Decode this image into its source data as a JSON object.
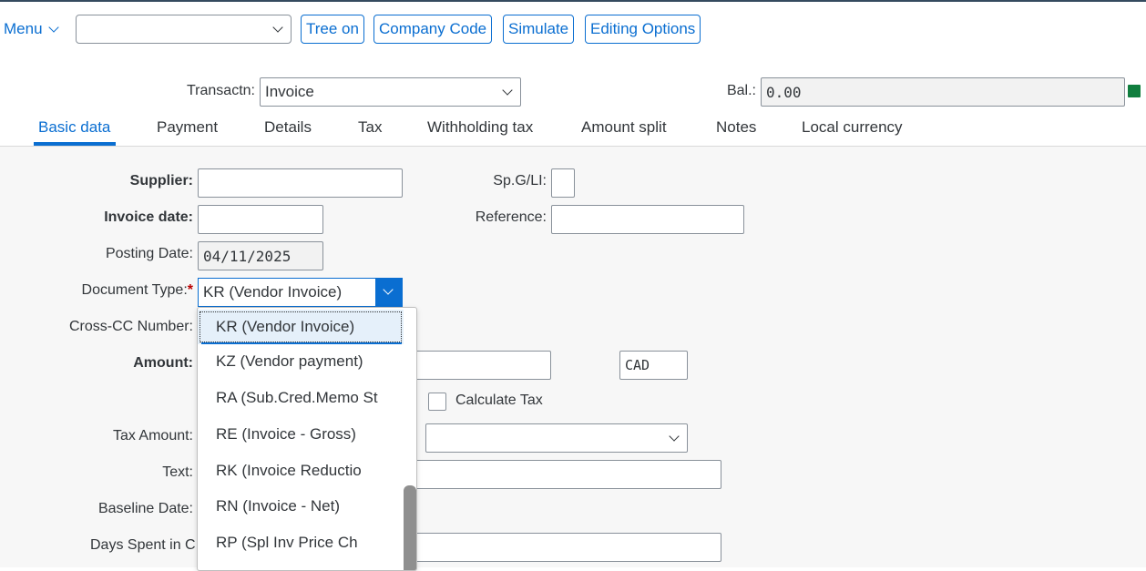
{
  "toolbar": {
    "menu_label": "Menu",
    "select_value": "",
    "buttons": [
      "Tree on",
      "Company Code",
      "Simulate",
      "Editing Options"
    ]
  },
  "header": {
    "transaction_label": "Transactn:",
    "transaction_value": "Invoice",
    "balance_label": "Bal.:",
    "balance_value": "0.00",
    "status_color": "#107e3e"
  },
  "tabs": [
    {
      "label": "Basic data",
      "active": true
    },
    {
      "label": "Payment",
      "active": false
    },
    {
      "label": "Details",
      "active": false
    },
    {
      "label": "Tax",
      "active": false
    },
    {
      "label": "Withholding tax",
      "active": false
    },
    {
      "label": "Amount split",
      "active": false
    },
    {
      "label": "Notes",
      "active": false
    },
    {
      "label": "Local currency",
      "active": false
    }
  ],
  "form": {
    "supplier_label": "Supplier:",
    "supplier_value": "",
    "spgl_label": "Sp.G/LI:",
    "spgl_value": "",
    "invoice_date_label": "Invoice date:",
    "invoice_date_value": "",
    "reference_label": "Reference:",
    "reference_value": "",
    "posting_date_label": "Posting Date:",
    "posting_date_value": "04/11/2025",
    "document_type_label": "Document Type:",
    "document_type_required": "*",
    "document_type_value": "KR (Vendor Invoice)",
    "cross_cc_label": "Cross-CC Number:",
    "amount_label": "Amount:",
    "currency_value": "CAD",
    "calculate_tax_label": "Calculate Tax",
    "calculate_tax_checked": false,
    "tax_amount_label": "Tax Amount:",
    "text_label": "Text:",
    "baseline_date_label": "Baseline Date:",
    "days_spent_label": "Days Spent in C"
  },
  "dropdown": {
    "options": [
      "KR (Vendor Invoice)",
      "KZ (Vendor payment)",
      "RA (Sub.Cred.Memo St",
      "RE (Invoice - Gross)",
      "RK (Invoice Reductio",
      "RN (Invoice - Net)",
      "RP (Spl Inv Price Ch"
    ],
    "selected_index": 0
  },
  "colors": {
    "accent": "#0a6ed1",
    "shell": "#354a5f",
    "required": "#bb0000"
  },
  "icons": [
    "chevron-down-icon",
    "checkbox-icon"
  ]
}
